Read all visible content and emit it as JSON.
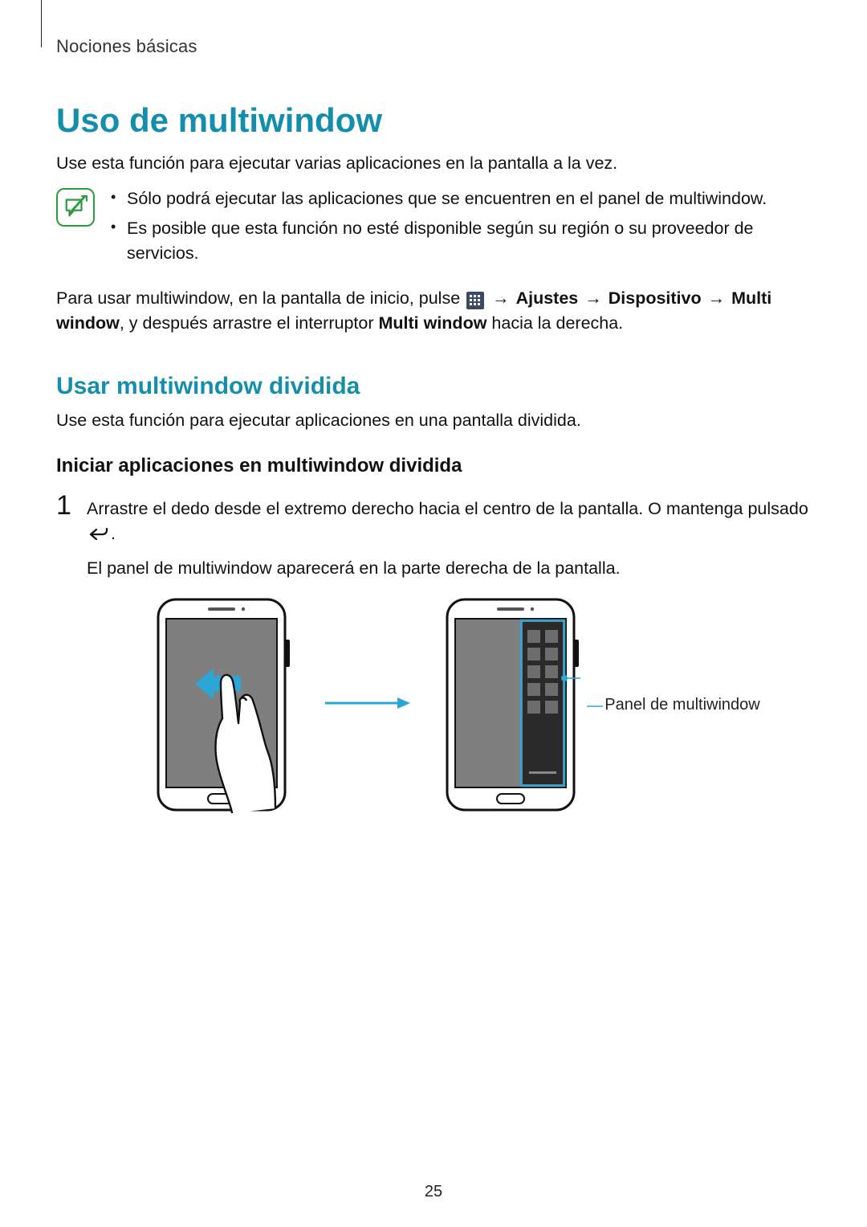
{
  "header": {
    "section": "Nociones básicas"
  },
  "title": "Uso de multiwindow",
  "lead": "Use esta función para ejecutar varias aplicaciones en la pantalla a la vez.",
  "note": {
    "items": [
      "Sólo podrá ejecutar las aplicaciones que se encuentren en el panel de multiwindow.",
      "Es posible que esta función no esté disponible según su región o su proveedor de servicios."
    ]
  },
  "instruction": {
    "pre": "Para usar multiwindow, en la pantalla de inicio, pulse ",
    "arrow": " → ",
    "path": [
      "Ajustes",
      "Dispositivo",
      "Multi window"
    ],
    "mid": ", y después arrastre el interruptor ",
    "switch_label": "Multi window",
    "post": " hacia la derecha."
  },
  "section2": "Usar multiwindow dividida",
  "section2_lead": "Use esta función para ejecutar aplicaciones en una pantalla dividida.",
  "subsection": "Iniciar aplicaciones en multiwindow dividida",
  "step1": {
    "num": "1",
    "text_a": "Arrastre el dedo desde el extremo derecho hacia el centro de la pantalla. O mantenga pulsado ",
    "period": ".",
    "text_b": "El panel de multiwindow aparecerá en la parte derecha de la pantalla."
  },
  "callout": "Panel de multiwindow",
  "page_number": "25"
}
